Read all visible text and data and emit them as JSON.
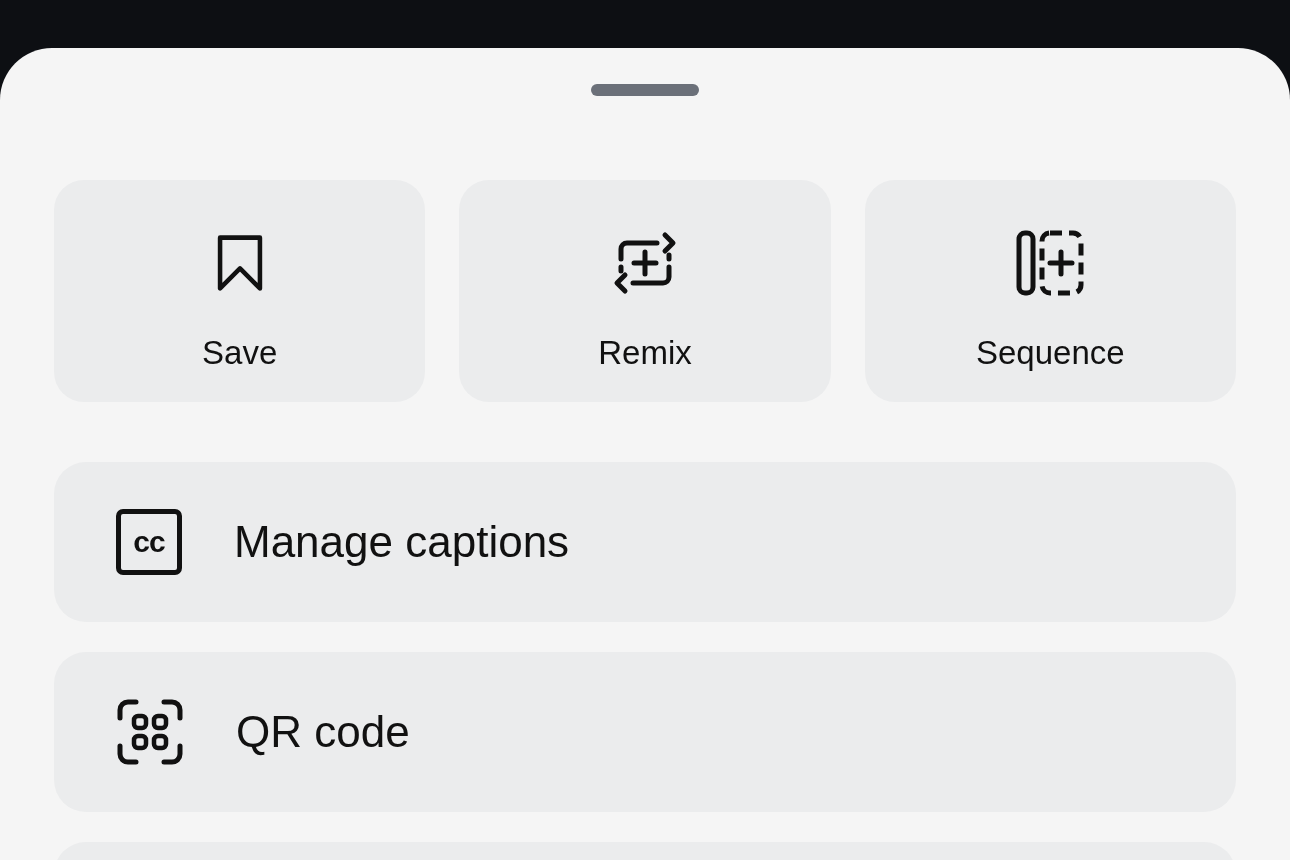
{
  "actions": [
    {
      "label": "Save"
    },
    {
      "label": "Remix"
    },
    {
      "label": "Sequence"
    }
  ],
  "menu": [
    {
      "kind": "item",
      "label": "Manage captions",
      "icon_text": "cc"
    },
    {
      "kind": "item",
      "label": "QR code"
    },
    {
      "kind": "partial"
    }
  ]
}
